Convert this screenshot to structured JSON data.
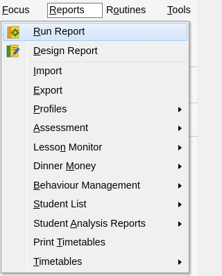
{
  "menubar": {
    "items": [
      {
        "label": "Focus",
        "mnemonic": "F"
      },
      {
        "label": "Reports",
        "mnemonic": "R",
        "active": true
      },
      {
        "label": "Routines",
        "mnemonic": "o"
      },
      {
        "label": "Tools",
        "mnemonic": "T"
      }
    ]
  },
  "dropdown": {
    "items": [
      {
        "label": "Run Report",
        "mnemonic": "R",
        "icon": "run-report-icon",
        "highlighted": true,
        "submenu": false
      },
      {
        "label": "Design Report",
        "mnemonic": "D",
        "icon": "design-report-icon",
        "submenu": false
      },
      {
        "label": "Import",
        "mnemonic": "I",
        "submenu": false
      },
      {
        "label": "Export",
        "mnemonic": "E",
        "submenu": false
      },
      {
        "label": "Profiles",
        "mnemonic": "P",
        "submenu": true
      },
      {
        "label": "Assessment",
        "mnemonic": "A",
        "submenu": true
      },
      {
        "label": "Lesson Monitor",
        "mnemonic": "n",
        "submenu": true
      },
      {
        "label": "Dinner Money",
        "mnemonic": "M",
        "submenu": true
      },
      {
        "label": "Behaviour Management",
        "mnemonic": "B",
        "submenu": true
      },
      {
        "label": "Student List",
        "mnemonic": "S",
        "submenu": true
      },
      {
        "label": "Student Analysis Reports",
        "mnemonic": "A",
        "submenu": true
      },
      {
        "label": "Print Timetables",
        "mnemonic": "T",
        "submenu": false
      },
      {
        "label": "Timetables",
        "mnemonic": "T",
        "submenu": true
      }
    ]
  },
  "colors": {
    "highlight_fill": "#d4e6f9",
    "highlight_border": "#a8cdf1",
    "menu_bg": "#f0f0f0"
  }
}
